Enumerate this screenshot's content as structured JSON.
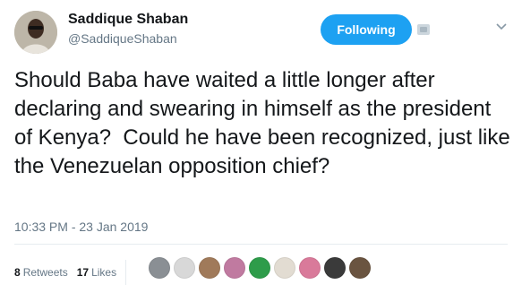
{
  "user": {
    "display_name": "Saddique Shaban",
    "handle": "@SaddiqueShaban",
    "avatar_icon": "user-avatar"
  },
  "follow_button": {
    "label": "Following"
  },
  "tweet": {
    "text": "Should Baba have waited a little longer after declaring and swearing in himself as the president of Kenya?  Could he have been recognized, just like the Venezuelan opposition chief?",
    "timestamp": "10:33 PM - 23 Jan 2019"
  },
  "stats": {
    "retweets_count": "8",
    "retweets_label": "Retweets",
    "likes_count": "17",
    "likes_label": "Likes"
  },
  "likers": [
    {
      "color": "#8a8f94"
    },
    {
      "color": "#d8d8d8"
    },
    {
      "color": "#a07a5a"
    },
    {
      "color": "#c07aa0"
    },
    {
      "color": "#2e9c4a"
    },
    {
      "color": "#e2dcd2"
    },
    {
      "color": "#d97a9a"
    },
    {
      "color": "#3a3a3a"
    },
    {
      "color": "#6a5440"
    }
  ],
  "colors": {
    "accent": "#1da1f2",
    "text": "#14171a",
    "muted": "#657786"
  }
}
